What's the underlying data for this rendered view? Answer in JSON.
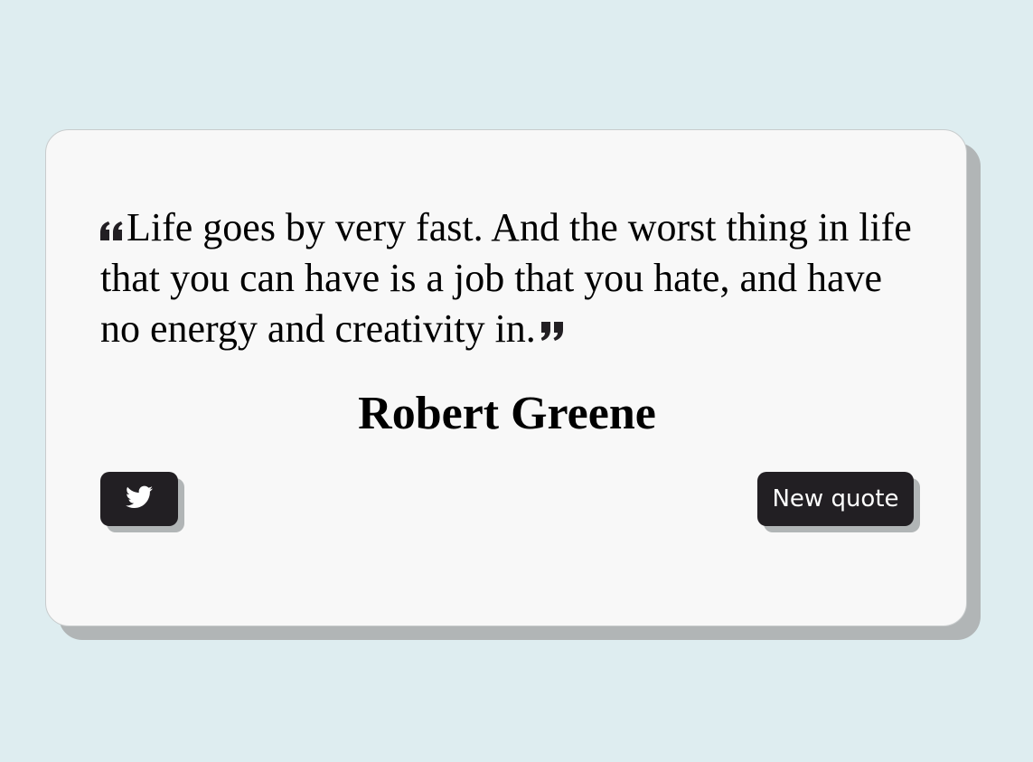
{
  "quote": {
    "text": "Life goes by very fast. And the worst thing in life that you can have is a job that you hate, and have no energy and creativity in.",
    "author": "Robert Greene"
  },
  "buttons": {
    "tweet_icon": "twitter-icon",
    "new_quote_label": "New quote"
  },
  "colors": {
    "background": "#deedf0",
    "card": "#f8f8f8",
    "shadow": "#b1b5b6",
    "button": "#221f23",
    "button_text": "#ffffff"
  }
}
